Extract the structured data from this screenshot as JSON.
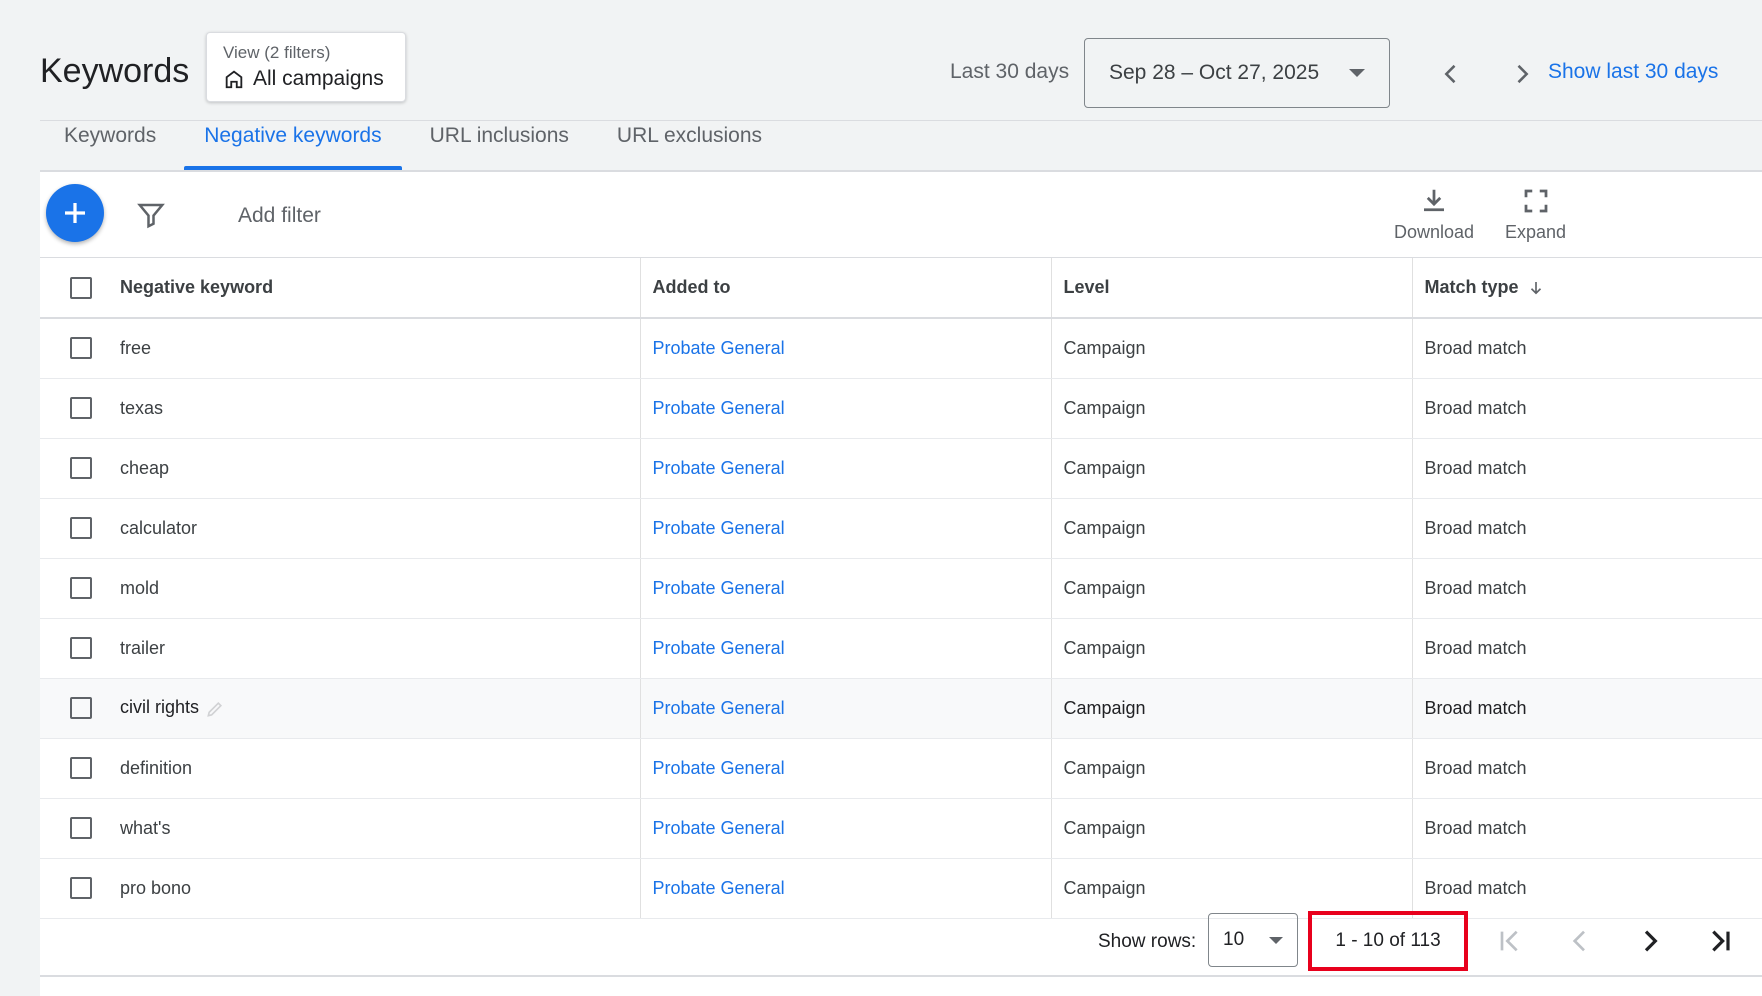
{
  "header": {
    "title": "Keywords",
    "view": {
      "subtitle": "View (2 filters)",
      "label": "All campaigns"
    },
    "range_label": "Last 30 days",
    "date_range": "Sep 28 – Oct 27, 2025",
    "show_last_link": "Show last 30 days"
  },
  "tabs": [
    {
      "label": "Keywords",
      "active": false
    },
    {
      "label": "Negative keywords",
      "active": true
    },
    {
      "label": "URL inclusions",
      "active": false
    },
    {
      "label": "URL exclusions",
      "active": false
    }
  ],
  "toolbar": {
    "add_filter": "Add filter",
    "download_label": "Download",
    "expand_label": "Expand"
  },
  "table": {
    "columns": [
      "Negative keyword",
      "Added to",
      "Level",
      "Match type"
    ],
    "rows": [
      {
        "keyword": "free",
        "added_to": "Probate General",
        "level": "Campaign",
        "match_type": "Broad match"
      },
      {
        "keyword": "texas",
        "added_to": "Probate General",
        "level": "Campaign",
        "match_type": "Broad match"
      },
      {
        "keyword": "cheap",
        "added_to": "Probate General",
        "level": "Campaign",
        "match_type": "Broad match"
      },
      {
        "keyword": "calculator",
        "added_to": "Probate General",
        "level": "Campaign",
        "match_type": "Broad match"
      },
      {
        "keyword": "mold",
        "added_to": "Probate General",
        "level": "Campaign",
        "match_type": "Broad match"
      },
      {
        "keyword": "trailer",
        "added_to": "Probate General",
        "level": "Campaign",
        "match_type": "Broad match"
      },
      {
        "keyword": "civil rights",
        "added_to": "Probate General",
        "level": "Campaign",
        "match_type": "Broad match"
      },
      {
        "keyword": "definition",
        "added_to": "Probate General",
        "level": "Campaign",
        "match_type": "Broad match"
      },
      {
        "keyword": "what's",
        "added_to": "Probate General",
        "level": "Campaign",
        "match_type": "Broad match"
      },
      {
        "keyword": "pro bono",
        "added_to": "Probate General",
        "level": "Campaign",
        "match_type": "Broad match"
      }
    ]
  },
  "footer": {
    "show_rows_label": "Show rows:",
    "rows_value": "10",
    "page_range": "1 - 10 of 113"
  },
  "colors": {
    "accent": "#1a73e8",
    "highlight_box": "#e8001c"
  }
}
